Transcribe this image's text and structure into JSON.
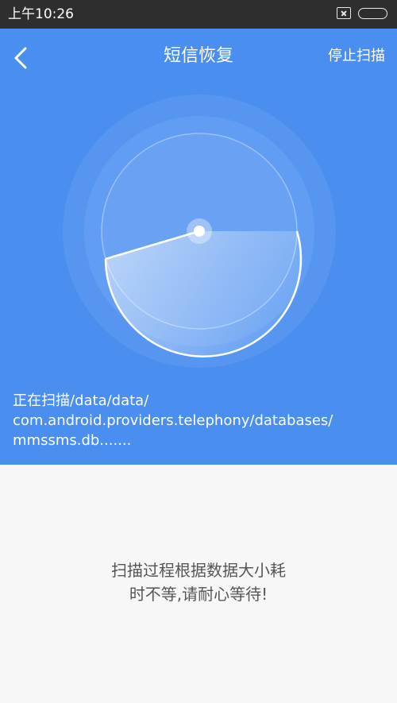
{
  "status_bar": {
    "time": "上午10:26",
    "icons": [
      "sim-card-icon",
      "battery-icon"
    ]
  },
  "header": {
    "back_icon": "chevron-left-icon",
    "title": "短信恢复",
    "stop_label": "停止扫描"
  },
  "scan": {
    "line1": "正在扫描/data/data/",
    "line2": "com.android.providers.telephony/databases/",
    "line3": "mmssms.db......."
  },
  "hint": {
    "line1": "扫描过程根据数据大小耗",
    "line2": "时不等,请耐心等待!"
  },
  "colors": {
    "status_bar": "#2e2e2e",
    "hero_background": "#4a8ef0",
    "content_background": "#f7f7f7",
    "hint_text": "#555555"
  }
}
